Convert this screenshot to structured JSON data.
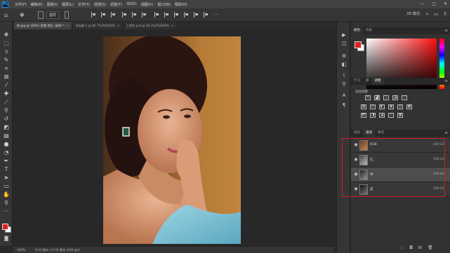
{
  "menubar": {
    "logo": "Ps",
    "items": [
      "文件(F)",
      "编辑(E)",
      "图像(I)",
      "图层(L)",
      "文字(Y)",
      "选择(S)",
      "滤镜(T)",
      "3D(D)",
      "视图(V)",
      "窗口(W)",
      "帮助(H)"
    ],
    "window_controls": [
      "—",
      "□",
      "✕"
    ]
  },
  "optionsbar": {
    "auto_select_target": "图层",
    "right_icons": [
      "3D 模式:",
      "⌕",
      "▭",
      "⇪"
    ]
  },
  "tabs": [
    {
      "label": "前.jpg @ 100% (背景 拷贝, 绿/8) *",
      "active": true
    },
    {
      "label": "未标题-1 @ 66.7%(RGB/8#)",
      "active": false
    },
    {
      "label": "三原色.psd @ 66.7%(RGB/8#)",
      "active": false
    }
  ],
  "statusbar": {
    "zoom": "100%",
    "doc_info": "6.23 厘米 x 9.32 厘米 (240 ppi)"
  },
  "color_panel": {
    "tabs": [
      "颜色",
      "色板"
    ],
    "foreground": "#e02020",
    "background": "#ffffff"
  },
  "adjustments_panel": {
    "tabs": [
      "学习",
      "库",
      "调整"
    ],
    "title": "添加调整"
  },
  "layers_panel": {
    "tabs": [
      "图层",
      "通道",
      "路径"
    ],
    "active_tab": "通道",
    "channels": [
      {
        "name": "RGB",
        "shortcut": "Ctrl+2",
        "selected": false
      },
      {
        "name": "红",
        "shortcut": "Ctrl+3",
        "selected": false
      },
      {
        "name": "绿",
        "shortcut": "Ctrl+4",
        "selected": true
      },
      {
        "name": "蓝",
        "shortcut": "Ctrl+5",
        "selected": false
      }
    ]
  },
  "colors": {
    "highlight": "#d81e1e",
    "app_bg": "#282828",
    "panel_bg": "#323232"
  }
}
